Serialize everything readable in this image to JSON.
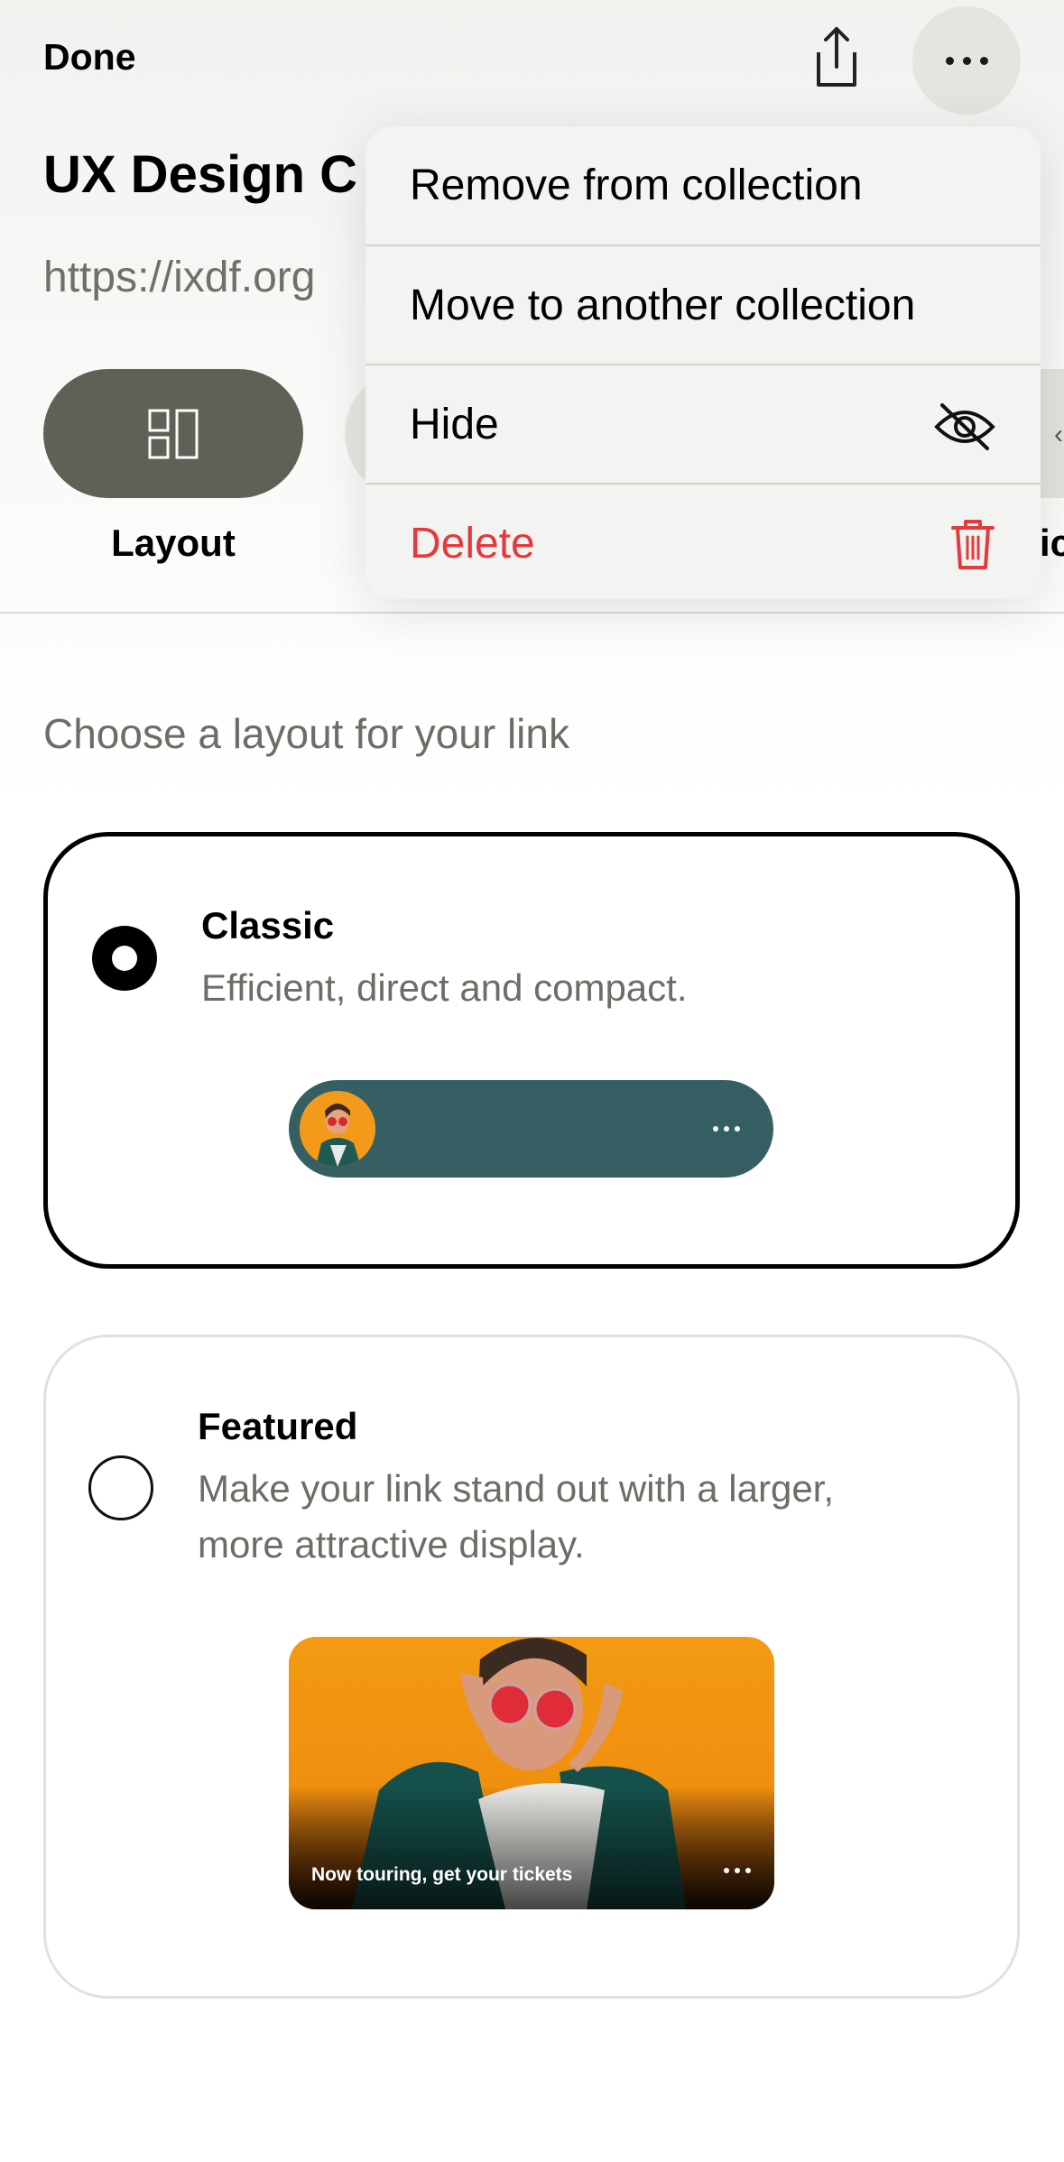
{
  "header": {
    "done_label": "Done",
    "share_icon": "share-icon",
    "more_icon": "more-icon"
  },
  "link": {
    "title": "UX Design C",
    "url": "https://ixdf.org"
  },
  "tabs": [
    {
      "label": "Layout",
      "icon": "layout-icon",
      "selected": true
    },
    {
      "label": "ic",
      "icon": "",
      "selected": false
    }
  ],
  "menu": {
    "items": [
      {
        "label": "Remove from collection"
      },
      {
        "label": "Move to another collection"
      },
      {
        "label": "Hide",
        "icon": "eye-off-icon"
      },
      {
        "label": "Delete",
        "icon": "trash-icon",
        "destructive": true
      }
    ]
  },
  "layout_section": {
    "prompt": "Choose a layout for your link",
    "options": [
      {
        "title": "Classic",
        "description": "Efficient, direct and compact.",
        "selected": true
      },
      {
        "title": "Featured",
        "description_line1": "Make your link stand out with a larger,",
        "description_line2": "more attractive display.",
        "selected": false
      }
    ],
    "featured_preview_caption": "Now touring, get your tickets"
  },
  "colors": {
    "accent_pill": "#5e6155",
    "classic_bar": "#355f63",
    "destructive": "#e5393c",
    "preview_orange": "#f39a12"
  }
}
